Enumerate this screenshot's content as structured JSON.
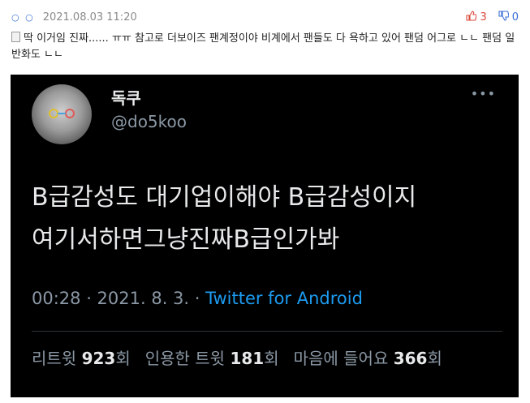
{
  "comment": {
    "date": "2021.08.03 11:20",
    "upvotes": "3",
    "downvotes": "0",
    "text": "딱 이거임 진짜...... ㅠㅠ 참고로 더보이즈 팬계정이야 비계에서 팬들도 다 욕하고 있어 팬덤 어그로 ㄴㄴ 팬덤 일반화도 ㄴㄴ"
  },
  "tweet": {
    "name": "독쿠",
    "handle": "@do5koo",
    "body_line1": "B급감성도 대기업이해야 B급감성이지",
    "body_line2": "여기서하면그냥진짜B급인가봐",
    "time": "00:28 · 2021. 8. 3. · ",
    "source": "Twitter for Android",
    "stats": [
      {
        "label": "리트윗",
        "count": "923",
        "unit": "회"
      },
      {
        "label": "인용한 트윗",
        "count": "181",
        "unit": "회"
      },
      {
        "label": "마음에 들어요",
        "count": "366",
        "unit": "회"
      }
    ]
  }
}
